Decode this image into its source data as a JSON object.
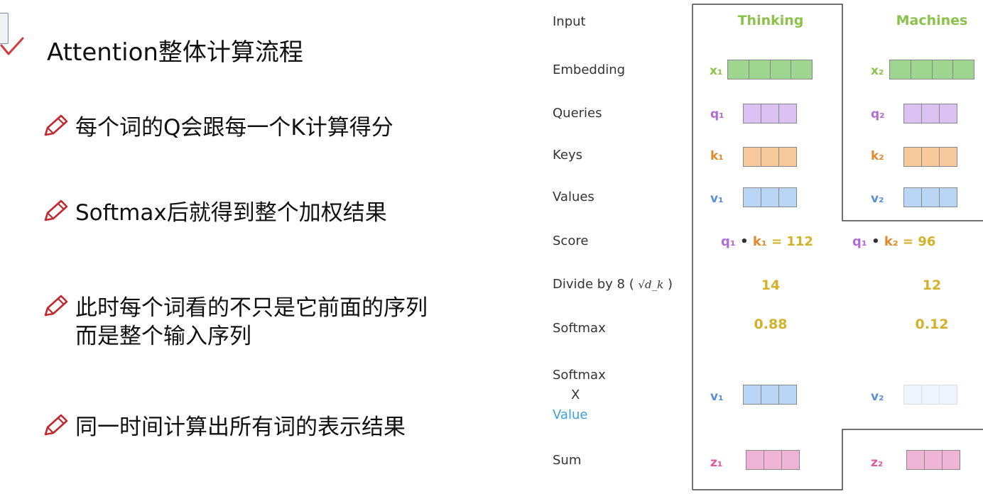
{
  "slide": {
    "title": "Attention整体计算流程",
    "bullets": [
      {
        "lines": [
          "每个词的Q会跟每一个K计算得分"
        ]
      },
      {
        "lines": [
          "Softmax后就得到整个加权结果"
        ]
      },
      {
        "lines": [
          "此时每个词看的不只是它前面的序列",
          "而是整个输入序列"
        ]
      },
      {
        "lines": [
          "同一时间计算出所有词的表示结果"
        ]
      }
    ]
  },
  "diagram": {
    "row_labels": {
      "input": "Input",
      "embedding": "Embedding",
      "queries": "Queries",
      "keys": "Keys",
      "values": "Values",
      "score": "Score",
      "divide": "Divide by 8 (",
      "divide_close": ")",
      "divide_formula": "√d_k",
      "softmax": "Softmax",
      "softmax_x_value": [
        "Softmax",
        "X",
        "Value"
      ],
      "sum": "Sum"
    },
    "columns": [
      {
        "word": "Thinking",
        "x": "x₁",
        "q": "q₁",
        "k": "k₁",
        "v": "v₁",
        "v_weighted": "v₁",
        "z": "z₁",
        "score": {
          "q": "q₁",
          "dot": "•",
          "k": "k₁",
          "eq": "= 112"
        },
        "divided": "14",
        "softmax": "0.88"
      },
      {
        "word": "Machines",
        "x": "x₂",
        "q": "q₂",
        "k": "k₂",
        "v": "v₂",
        "v_weighted": "v₂",
        "z": "z₂",
        "score": {
          "q": "q₁",
          "dot": "•",
          "k": "k₂",
          "eq": "= 96"
        },
        "divided": "12",
        "softmax": "0.12"
      }
    ],
    "colors": {
      "word": "#8bc34a",
      "x_label": "#8bc34a",
      "embedding_fill": "#9ed58f",
      "q_label": "#b36bd6",
      "q_fill": "#dcc2f3",
      "k_label": "#e08a2c",
      "k_fill": "#f8c99a",
      "v_label": "#5b8fd6",
      "v_fill": "#b9d7f5",
      "v_faded_fill": "#eef4fb",
      "z_label": "#e05a9a",
      "z_fill": "#f0b4d6",
      "number": "#d4b12a",
      "value_word": "#3aa0d8"
    }
  }
}
